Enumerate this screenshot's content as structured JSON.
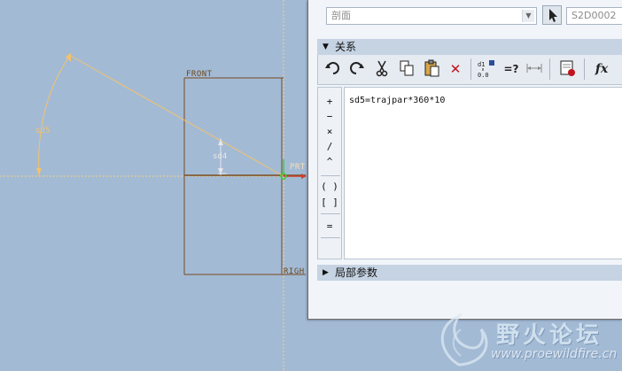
{
  "sketch": {
    "front_label": "FRONT",
    "right_label": "RIGH",
    "prt_label": "PRT",
    "dim_angle": "sd5",
    "dim_length": "sd4"
  },
  "dialog": {
    "type_combo": {
      "value": "剖面"
    },
    "id_field": {
      "value": "S2D0002"
    },
    "relations_section": {
      "title": "关系"
    },
    "editor": {
      "text": "sd5=trajpar*360*10"
    },
    "operators": [
      "+",
      "−",
      "×",
      "/",
      "^",
      "( )",
      "[ ]",
      "="
    ],
    "local_params_section": {
      "title": "局部参数"
    }
  },
  "watermark": {
    "title": "野火论坛",
    "url": "www.proewildfire.cn"
  },
  "colors": {
    "background": "#a3bad5",
    "sketch_line": "#7a4a1e",
    "dimension": "#f2c36b",
    "section_header": "#c5d3e3"
  }
}
